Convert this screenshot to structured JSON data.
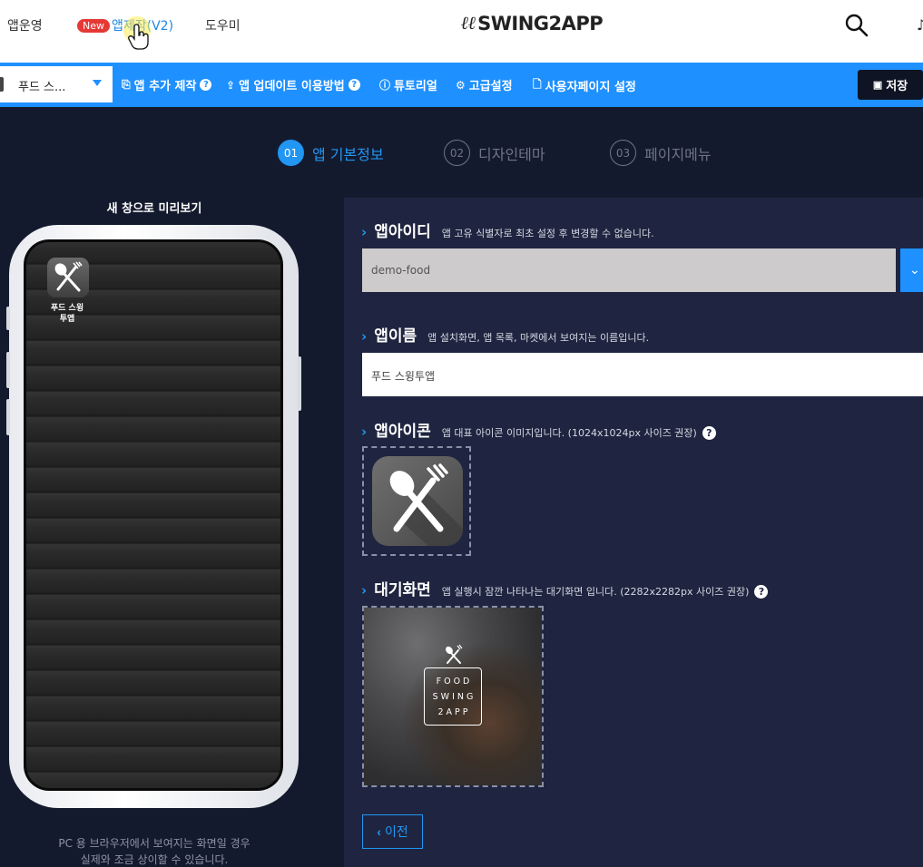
{
  "topnav": {
    "items": [
      {
        "label": "앱운영"
      },
      {
        "badge": "New",
        "label": "앱제작(V2)"
      },
      {
        "label": "도우미"
      }
    ],
    "logo_text": "SWING2APP",
    "logo_mark": "ℓℓ"
  },
  "toolbar": {
    "app_select_value": "푸드 스...",
    "items": [
      {
        "label": "앱 추가 제작",
        "icon": "copy-icon"
      },
      {
        "label": "앱 업데이트 이용방법",
        "icon": "upload-icon"
      },
      {
        "label": "튜토리얼",
        "icon": "question-circle-icon"
      },
      {
        "label": "고급설정",
        "icon": "gear-icon"
      },
      {
        "label": "사용자페이지 설정",
        "icon": "document-icon"
      }
    ],
    "help_mark": "?",
    "save_label": "저장"
  },
  "steps": [
    {
      "num": "01",
      "label": "앱 기본정보",
      "active": true
    },
    {
      "num": "02",
      "label": "디자인테마",
      "active": false
    },
    {
      "num": "03",
      "label": "페이지메뉴",
      "active": false
    }
  ],
  "preview": {
    "title": "새 창으로 미리보기",
    "icon_label_line1": "푸드 스윙",
    "icon_label_line2": "투앱",
    "note_line1": "PC 용 브라우저에서 보여지는 화면일 경우",
    "note_line2": "실제와 조금 상이할 수 있습니다."
  },
  "form": {
    "app_id": {
      "title": "앱아이디",
      "desc": "앱 고유 식별자로 최초 설정 후 변경할 수 없습니다.",
      "value": "demo-food"
    },
    "app_name": {
      "title": "앱이름",
      "desc": "앱 설치화면, 앱 목록, 마켓에서 보여지는 이름입니다.",
      "value": "푸드 스윙투앱"
    },
    "app_icon": {
      "title": "앱아이콘",
      "desc": "앱 대표 아이콘 이미지입니다. (1024x1024px 사이즈 권장)"
    },
    "splash": {
      "title": "대기화면",
      "desc": "앱 실행시 잠깐 나타나는 대기화면 입니다. (2282x2282px 사이즈 권장)",
      "logo_lines": [
        "FOOD",
        "SWING",
        "2APP"
      ]
    },
    "prev_label": "이전"
  },
  "colors": {
    "accent": "#1e90ff",
    "background": "#141a2e",
    "panel": "#1f2540",
    "badge": "#e53935"
  }
}
